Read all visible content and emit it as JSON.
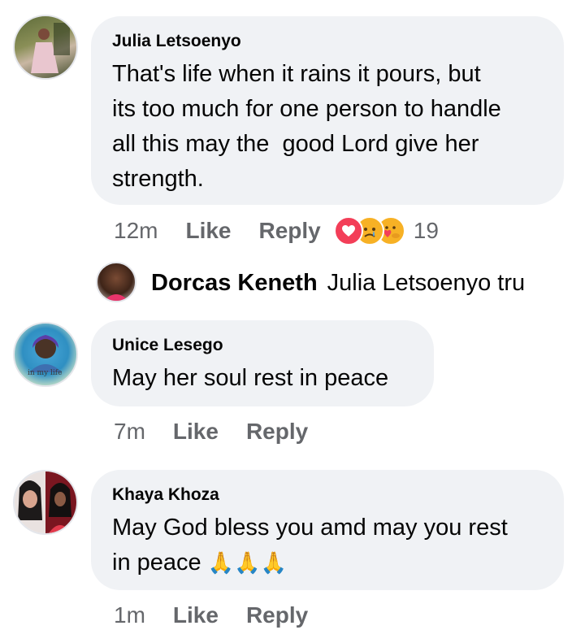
{
  "comments": [
    {
      "author": "Julia Letsoenyo",
      "text": "That's life when it rains it pours, but\nits too much for one person to handle\nall this may the  good Lord give her\nstrength.",
      "time": "12m",
      "like": "Like",
      "reply": "Reply",
      "reactions": [
        "love",
        "sad",
        "care"
      ],
      "reaction_count": "19",
      "avatar": "avatar-photo"
    },
    {
      "author": "Unice Lesego",
      "text": "May her soul rest in peace",
      "time": "7m",
      "like": "Like",
      "reply": "Reply",
      "avatar": "avatar-photo",
      "avatar_caption": "in my life"
    },
    {
      "author": "Khaya Khoza",
      "text": "May God bless you amd may you rest\nin peace ",
      "emoji": "🙏🙏🙏",
      "time": "1m",
      "like": "Like",
      "reply": "Reply",
      "avatar": "avatar-photo"
    }
  ],
  "reply_preview": {
    "author": "Dorcas Keneth",
    "text": "Julia Letsoenyo tru",
    "avatar": "avatar-photo"
  },
  "colors": {
    "bubble": "#f0f2f5",
    "meta": "#65676b",
    "text": "#050505",
    "love": "#f33e58",
    "sad": "#f7b125"
  }
}
